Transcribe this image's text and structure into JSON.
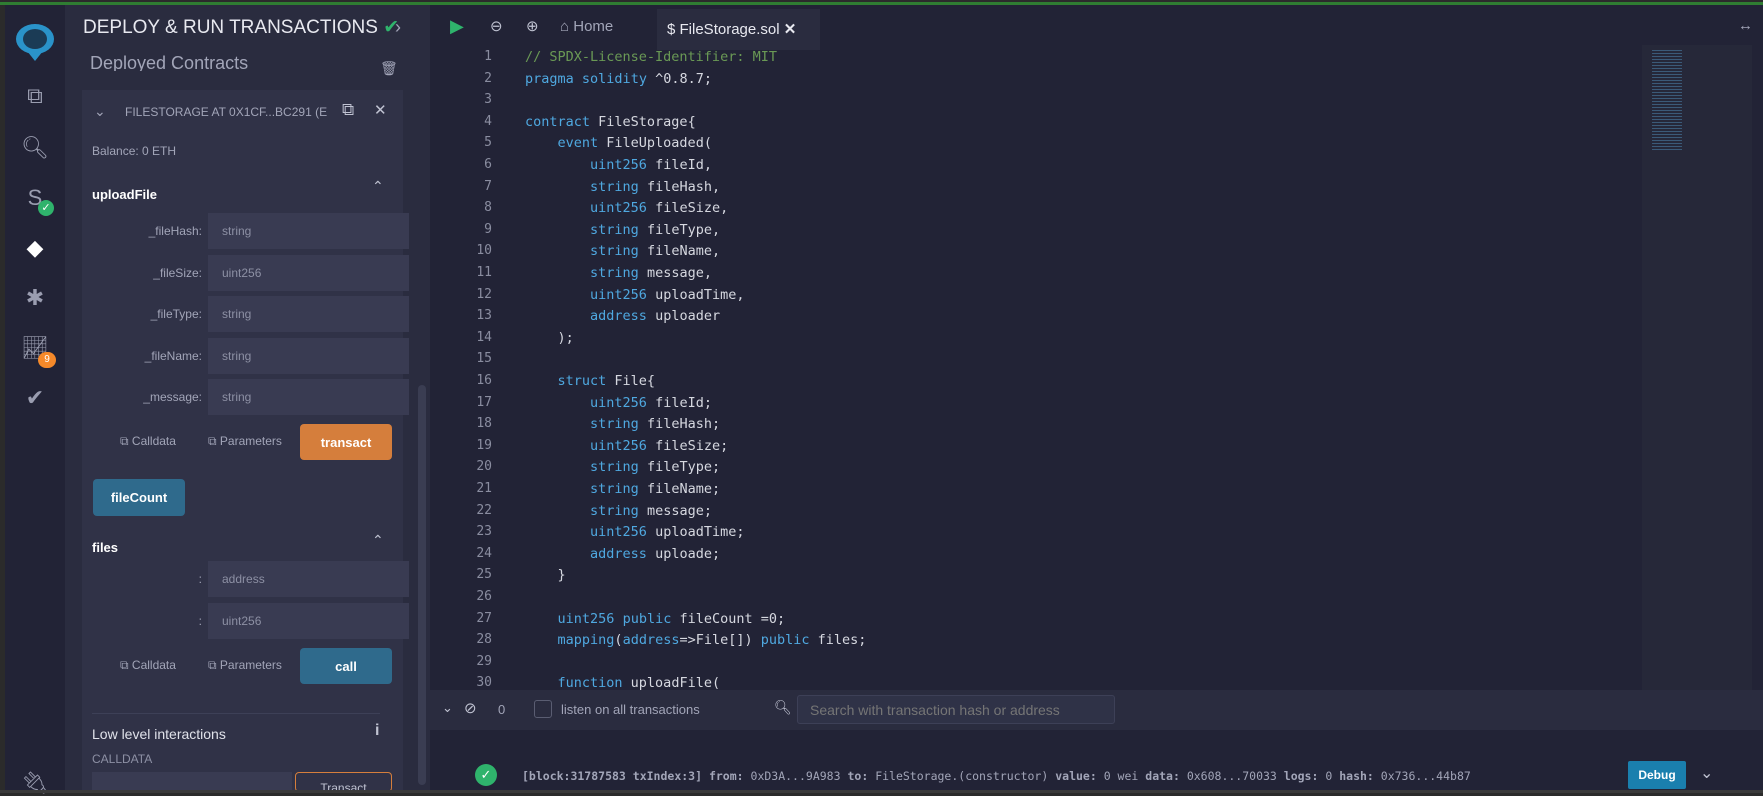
{
  "panel": {
    "title": "DEPLOY & RUN TRANSACTIONS",
    "section": "Deployed Contracts",
    "contract_label": "FILESTORAGE AT 0X1CF...BC291 (E",
    "balance": "Balance: 0 ETH",
    "upload": {
      "name": "uploadFile",
      "fields": [
        {
          "label": "_fileHash:",
          "placeholder": "string"
        },
        {
          "label": "_fileSize:",
          "placeholder": "uint256"
        },
        {
          "label": "_fileType:",
          "placeholder": "string"
        },
        {
          "label": "_fileName:",
          "placeholder": "string"
        },
        {
          "label": "_message:",
          "placeholder": "string"
        }
      ],
      "calldata": "Calldata",
      "parameters": "Parameters",
      "action": "transact"
    },
    "filecount": "fileCount",
    "files": {
      "name": "files",
      "fields": [
        {
          "label": ":",
          "placeholder": "address"
        },
        {
          "label": ":",
          "placeholder": "uint256"
        }
      ],
      "calldata": "Calldata",
      "parameters": "Parameters",
      "action": "call"
    },
    "low_level": "Low level interactions",
    "calldata_label": "CALLDATA",
    "transact_outline": "Transact"
  },
  "iconbar": {
    "analysis_badge": "9"
  },
  "tabs": {
    "home": "Home",
    "file": "FileStorage.sol"
  },
  "code": [
    "// SPDX-License-Identifier: MIT",
    "pragma solidity ^0.8.7;",
    "",
    "contract FileStorage{",
    "    event FileUploaded(",
    "        uint256 fileId,",
    "        string fileHash,",
    "        uint256 fileSize,",
    "        string fileType,",
    "        string fileName,",
    "        string message,",
    "        uint256 uploadTime,",
    "        address uploader",
    "    );",
    "",
    "    struct File{",
    "        uint256 fileId;",
    "        string fileHash;",
    "        uint256 fileSize;",
    "        string fileType;",
    "        string fileName;",
    "        string message;",
    "        uint256 uploadTime;",
    "        address uploade;",
    "    }",
    "",
    "    uint256 public fileCount =0;",
    "    mapping(address=>File[]) public files;",
    "",
    "    function uploadFile("
  ],
  "terminal": {
    "count": "0",
    "listen": "listen on all transactions",
    "search_placeholder": "Search with transaction hash or address",
    "log": {
      "block": "[block:31787583 txIndex:3]",
      "from_k": "from:",
      "from": "0xD3A...9A983",
      "to_k": "to:",
      "to": "FileStorage.(constructor)",
      "value_k": "value:",
      "value": "0 wei",
      "data_k": "data:",
      "data": "0x608...70033",
      "logs_k": "logs:",
      "logs": "0",
      "hash_k": "hash:",
      "hash": "0x736...44b87"
    },
    "debug": "Debug"
  },
  "colors": {
    "transact": "#d57e3c",
    "call": "#2f6a8c",
    "debug": "#1a7fae",
    "success": "#2fb36c",
    "accent": "#2f7d32"
  }
}
